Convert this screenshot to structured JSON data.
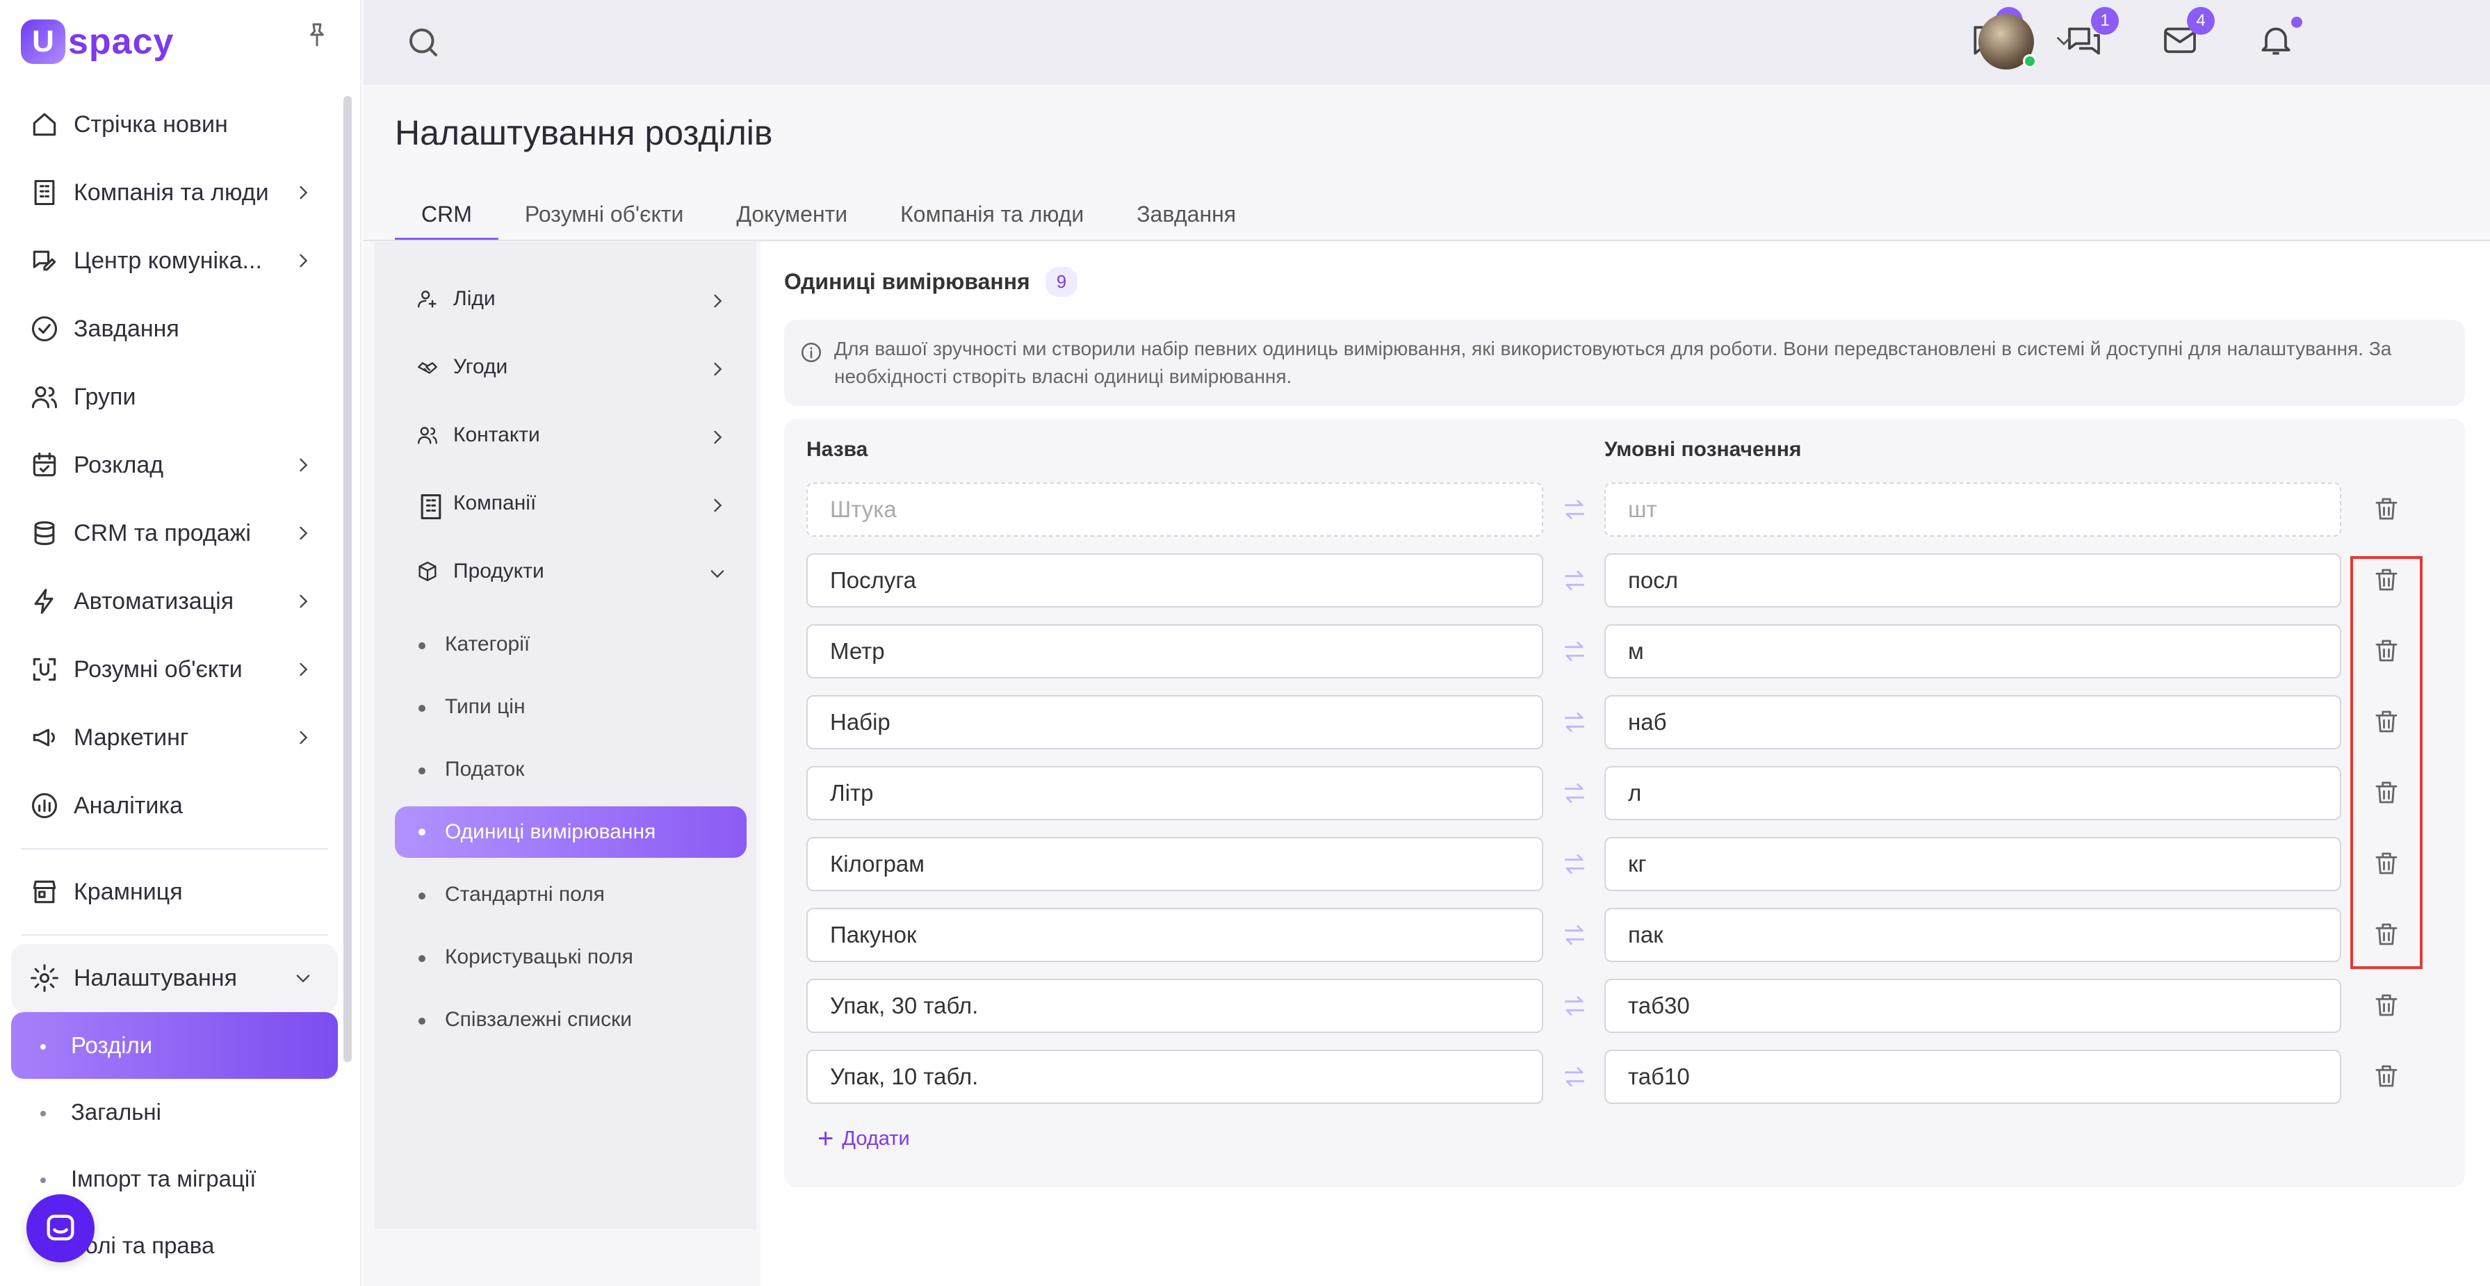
{
  "app": {
    "logo_letter": "U",
    "logo_text": "spacy"
  },
  "sidebar": {
    "items": [
      {
        "label": "Стрічка новин",
        "icon": "home-icon",
        "has_chevron": false
      },
      {
        "label": "Компанія та люди",
        "icon": "building-icon",
        "has_chevron": true
      },
      {
        "label": "Центр комуніка...",
        "icon": "chat-edit-icon",
        "has_chevron": true
      },
      {
        "label": "Завдання",
        "icon": "check-circle-icon",
        "has_chevron": false
      },
      {
        "label": "Групи",
        "icon": "users-icon",
        "has_chevron": false
      },
      {
        "label": "Розклад",
        "icon": "calendar-icon",
        "has_chevron": true
      },
      {
        "label": "CRM та продажі",
        "icon": "database-icon",
        "has_chevron": true
      },
      {
        "label": "Автоматизація",
        "icon": "lightning-icon",
        "has_chevron": true
      },
      {
        "label": "Розумні об'єкти",
        "icon": "smart-object-icon",
        "has_chevron": true
      },
      {
        "label": "Маркетинг",
        "icon": "megaphone-icon",
        "has_chevron": true
      },
      {
        "label": "Аналітика",
        "icon": "chart-icon",
        "has_chevron": false
      }
    ],
    "store": {
      "label": "Крамниця",
      "icon": "store-icon"
    },
    "settings": {
      "label": "Налаштування",
      "icon": "gear-icon"
    },
    "settings_sub": [
      {
        "label": "Розділи",
        "active": true
      },
      {
        "label": "Загальні",
        "active": false
      },
      {
        "label": "Імпорт та міграції",
        "active": false
      },
      {
        "label": "Ролі та права",
        "active": false
      }
    ]
  },
  "topbar": {
    "badges": {
      "chat": "1",
      "messages": "1",
      "mail": "4"
    }
  },
  "page": {
    "title": "Налаштування розділів",
    "tabs": [
      "CRM",
      "Розумні об'єкти",
      "Документи",
      "Компанія та люди",
      "Завдання"
    ],
    "active_tab": "CRM"
  },
  "menu": {
    "items": [
      {
        "label": "Ліди",
        "icon": "user-plus-icon",
        "expanded": false
      },
      {
        "label": "Угоди",
        "icon": "handshake-icon",
        "expanded": false
      },
      {
        "label": "Контакти",
        "icon": "contacts-icon",
        "expanded": false
      },
      {
        "label": "Компанії",
        "icon": "building-icon",
        "expanded": false
      },
      {
        "label": "Продукти",
        "icon": "box-icon",
        "expanded": true
      }
    ],
    "product_sub": [
      {
        "label": "Категорії",
        "active": false
      },
      {
        "label": "Типи цін",
        "active": false
      },
      {
        "label": "Податок",
        "active": false
      },
      {
        "label": "Одиниці вимірювання",
        "active": true
      },
      {
        "label": "Стандартні поля",
        "active": false
      },
      {
        "label": "Користувацькі поля",
        "active": false
      },
      {
        "label": "Співзалежні списки",
        "active": false
      }
    ]
  },
  "units": {
    "title": "Одиниці вимірювання",
    "count": "9",
    "info": "Для вашої зручності ми створили набір певних одиниць вимірювання, які використовуються для роботи. Вони передвстановлені в системі й доступні для налаштування. За необхідності створіть власні одиниці вимірювання.",
    "col_name": "Назва",
    "col_abbr": "Умовні позначення",
    "placeholder_row": {
      "name": "Штука",
      "abbr": "шт"
    },
    "rows": [
      {
        "name": "Послуга",
        "abbr": "посл"
      },
      {
        "name": "Метр",
        "abbr": "м"
      },
      {
        "name": "Набір",
        "abbr": "наб"
      },
      {
        "name": "Літр",
        "abbr": "л"
      },
      {
        "name": "Кілограм",
        "abbr": "кг"
      },
      {
        "name": "Пакунок",
        "abbr": "пак"
      },
      {
        "name": "Упак, 30 табл.",
        "abbr": "таб30"
      },
      {
        "name": "Упак, 10 табл.",
        "abbr": "таб10"
      }
    ],
    "add_label": "Додати"
  },
  "colors": {
    "accent": "#8b5cf6",
    "highlight": "#e53935"
  }
}
